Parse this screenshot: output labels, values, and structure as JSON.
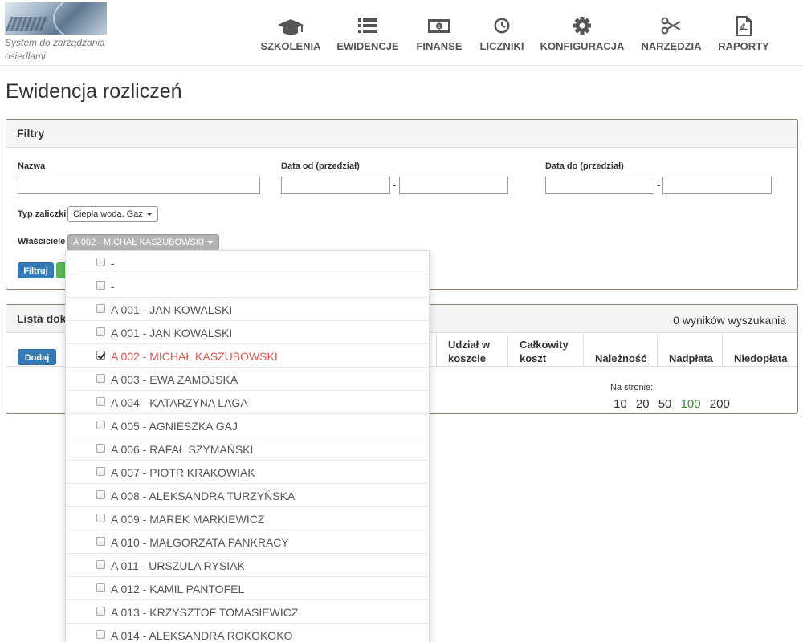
{
  "app": {
    "tagline": "System do zarządzania osiedlami"
  },
  "nav": [
    {
      "label": "SZKOLENIA",
      "icon": "graduation-cap-icon"
    },
    {
      "label": "EWIDENCJE",
      "icon": "list-icon"
    },
    {
      "label": "FINANSE",
      "icon": "money-icon"
    },
    {
      "label": "LICZNIKI",
      "icon": "clock-icon"
    },
    {
      "label": "KONFIGURACJA",
      "icon": "gear-icon"
    },
    {
      "label": "NARZĘDZIA",
      "icon": "scissors-icon"
    },
    {
      "label": "RAPORTY",
      "icon": "pdf-file-icon"
    }
  ],
  "page": {
    "title": "Ewidencja rozliczeń"
  },
  "filters": {
    "title": "Filtry",
    "name_label": "Nazwa",
    "name_value": "",
    "date_from_label": "Data od (przedział)",
    "date_to_label": "Data do (przedział)",
    "range_separator": "-",
    "advance_type_label": "Typ zaliczki",
    "advance_type_value": "Ciepła woda, Gaz",
    "owners_label": "Właściciele",
    "owners_value": "A 002 - MICHAŁ KASZUBOWSKI",
    "filter_button": "Filtruj"
  },
  "list": {
    "title": "Lista dok",
    "result_count": "0 wyników wyszukania",
    "add_button": "Dodaj",
    "columns": [
      {
        "label": "Udział w koszcie"
      },
      {
        "label": "Całkowity koszt"
      },
      {
        "label": "Należność"
      },
      {
        "label": "Nadpłata"
      },
      {
        "label": "Niedopłata"
      }
    ],
    "per_page_label": "Na stronie:",
    "per_page_options": [
      "10",
      "20",
      "50",
      "100",
      "200"
    ],
    "per_page_selected": "100"
  },
  "owners_dropdown": {
    "options": [
      {
        "label": "-",
        "checked": false
      },
      {
        "label": "-",
        "checked": false
      },
      {
        "label": "A 001 - JAN KOWALSKI",
        "checked": false
      },
      {
        "label": "A 001 - JAN KOWALSKI",
        "checked": false
      },
      {
        "label": "A 002 - MICHAŁ KASZUBOWSKI",
        "checked": true
      },
      {
        "label": "A 003 - EWA ZAMOJSKA",
        "checked": false
      },
      {
        "label": "A 004 - KATARZYNA LAGA",
        "checked": false
      },
      {
        "label": "A 005 - AGNIESZKA GAJ",
        "checked": false
      },
      {
        "label": "A 006 - RAFAŁ SZYMAŃSKI",
        "checked": false
      },
      {
        "label": "A 007 - PIOTR KRAKOWIAK",
        "checked": false
      },
      {
        "label": "A 008 - ALEKSANDRA TURZYŃSKA",
        "checked": false
      },
      {
        "label": "A 009 - MAREK MARKIEWICZ",
        "checked": false
      },
      {
        "label": "A 010 - MAŁGORZATA PANKRACY",
        "checked": false
      },
      {
        "label": "A 011 - URSZULA RYSIAK",
        "checked": false
      },
      {
        "label": "A 012 - KAMIL PANTOFEL",
        "checked": false
      },
      {
        "label": "A 013 - KRZYSZTOF TOMASIEWICZ",
        "checked": false
      },
      {
        "label": "A 014 - ALEKSANDRA ROKOKOKO",
        "checked": false
      }
    ]
  },
  "colors": {
    "primary": "#337ab7",
    "success": "#5cb85c",
    "checked_text": "#d9534f",
    "panel_border": "#8c8070"
  }
}
